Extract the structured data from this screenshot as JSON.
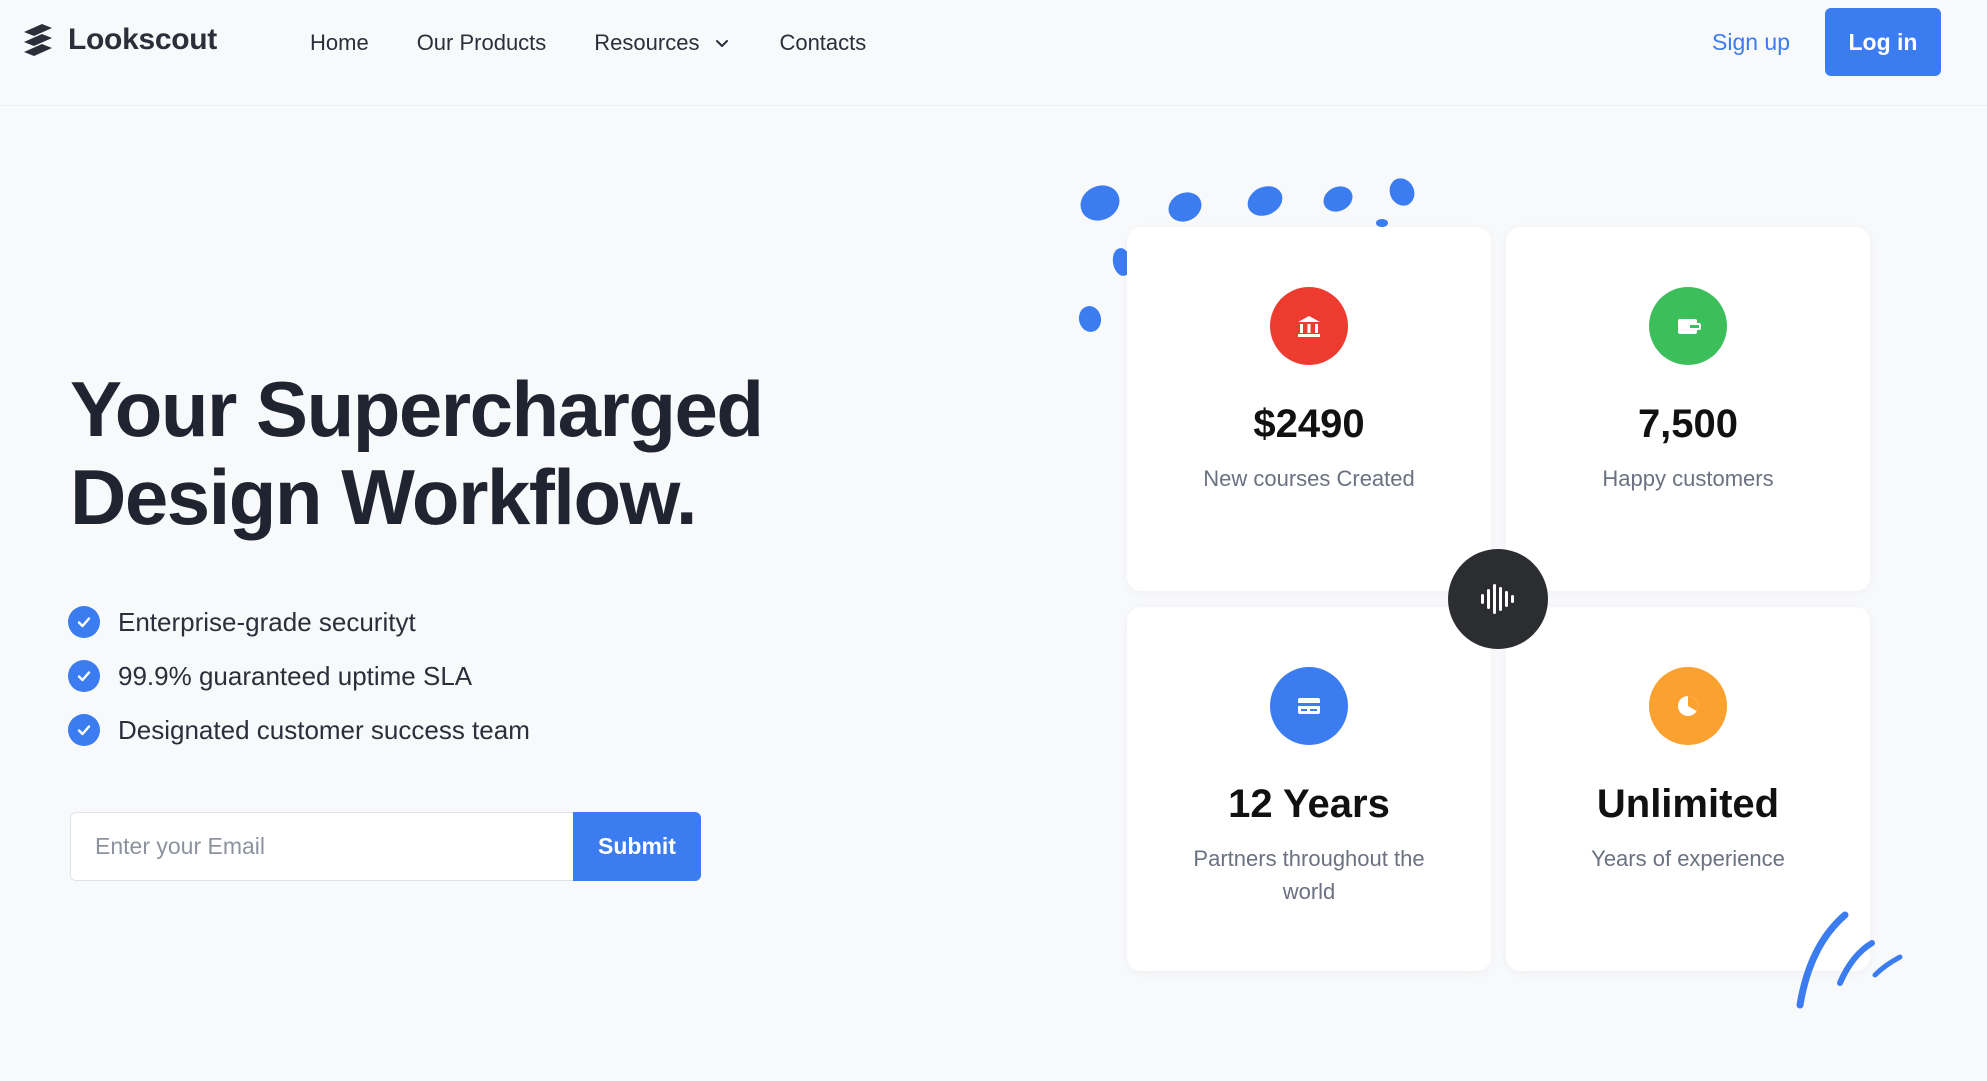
{
  "header": {
    "logo_text": "Lookscout",
    "nav": [
      {
        "label": "Home"
      },
      {
        "label": "Our Products"
      },
      {
        "label": "Resources",
        "has_dropdown": true
      },
      {
        "label": "Contacts"
      }
    ],
    "signup_label": "Sign up",
    "login_label": "Log in"
  },
  "hero": {
    "title_line1": "Your Supercharged",
    "title_line2": "Design Workflow.",
    "features": [
      "Enterprise-grade securityt",
      "99.9% guaranteed uptime SLA",
      "Designated customer success team"
    ],
    "email_placeholder": "Enter your Email",
    "submit_label": "Submit"
  },
  "stats": [
    {
      "value": "$2490",
      "label": "New courses Created",
      "icon": "bank-icon",
      "color": "#ee3b30"
    },
    {
      "value": "7,500",
      "label": "Happy customers",
      "icon": "wallet-icon",
      "color": "#3cbf5a"
    },
    {
      "value": "12 Years",
      "label": "Partners throughout the world",
      "icon": "credit-card-icon",
      "color": "#3b7cf0"
    },
    {
      "value": "Unlimited",
      "label": "Years of experience",
      "icon": "pie-chart-icon",
      "color": "#fba130"
    }
  ],
  "colors": {
    "accent": "#3b7cf0",
    "text": "#1f2430",
    "muted": "#6b7180",
    "dark_button": "#2c2d30"
  }
}
